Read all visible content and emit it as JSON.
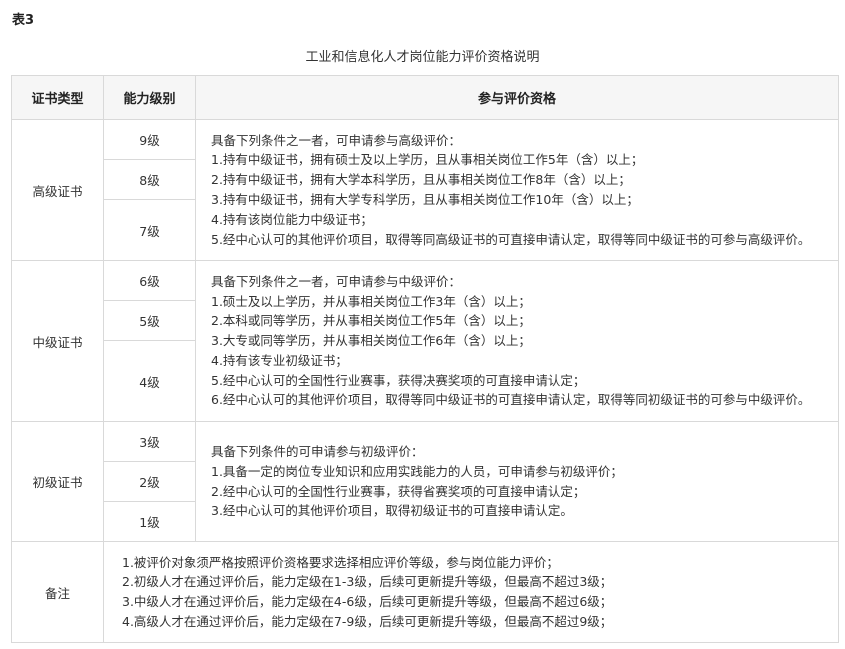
{
  "table_label": "表3",
  "caption": "工业和信息化人才岗位能力评价资格说明",
  "headers": {
    "type": "证书类型",
    "level": "能力级别",
    "qualification": "参与评价资格"
  },
  "advanced": {
    "type": "高级证书",
    "levels": [
      "9级",
      "8级",
      "7级"
    ],
    "lines": [
      "具备下列条件之一者，可申请参与高级评价：",
      "1.持有中级证书，拥有硕士及以上学历，且从事相关岗位工作5年（含）以上；",
      "2.持有中级证书，拥有大学本科学历，且从事相关岗位工作8年（含）以上；",
      "3.持有中级证书，拥有大学专科学历，且从事相关岗位工作10年（含）以上；",
      "4.持有该岗位能力中级证书；",
      "5.经中心认可的其他评价项目，取得等同高级证书的可直接申请认定，取得等同中级证书的可参与高级评价。"
    ]
  },
  "intermediate": {
    "type": "中级证书",
    "levels": [
      "6级",
      "5级",
      "4级"
    ],
    "lines": [
      "具备下列条件之一者，可申请参与中级评价：",
      "1.硕士及以上学历，并从事相关岗位工作3年（含）以上；",
      "2.本科或同等学历，并从事相关岗位工作5年（含）以上；",
      "3.大专或同等学历，并从事相关岗位工作6年（含）以上；",
      "4.持有该专业初级证书；",
      "5.经中心认可的全国性行业赛事，获得决赛奖项的可直接申请认定；",
      "6.经中心认可的其他评价项目，取得等同中级证书的可直接申请认定，取得等同初级证书的可参与中级评价。"
    ]
  },
  "junior": {
    "type": "初级证书",
    "levels": [
      "3级",
      "2级",
      "1级"
    ],
    "lines": [
      "具备下列条件的可申请参与初级评价：",
      "1.具备一定的岗位专业知识和应用实践能力的人员，可申请参与初级评价；",
      "2.经中心认可的全国性行业赛事，获得省赛奖项的可直接申请认定；",
      "3.经中心认可的其他评价项目，取得初级证书的可直接申请认定。"
    ]
  },
  "notes": {
    "type": "备注",
    "lines": [
      "1.被评价对象须严格按照评价资格要求选择相应评价等级，参与岗位能力评价；",
      "2.初级人才在通过评价后，能力定级在1-3级，后续可更新提升等级，但最高不超过3级；",
      "3.中级人才在通过评价后，能力定级在4-6级，后续可更新提升等级，但最高不超过6级；",
      "4.高级人才在通过评价后，能力定级在7-9级，后续可更新提升等级，但最高不超过9级；"
    ]
  }
}
